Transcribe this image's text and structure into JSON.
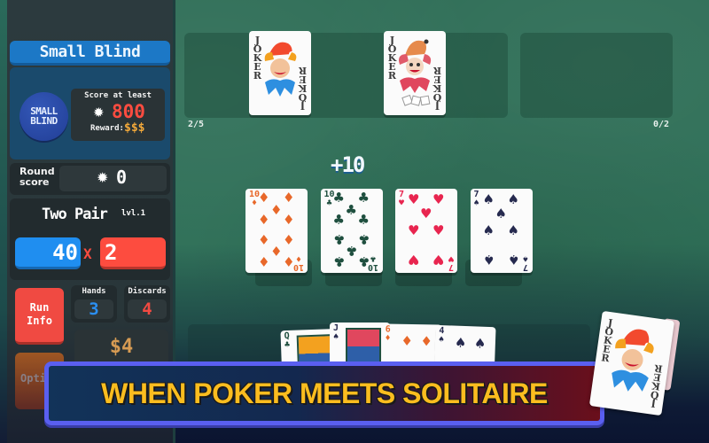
{
  "sidebar": {
    "blind_title": "Small Blind",
    "blind_chip": [
      "SMALL",
      "BLIND"
    ],
    "score_label": "Score at least",
    "score_icon": "chip-icon",
    "score_target": "800",
    "reward_label": "Reward:",
    "reward_value": "$$$",
    "round_label_1": "Round",
    "round_label_2": "score",
    "round_score": "0",
    "hand_name": "Two Pair",
    "hand_level": "lvl.1",
    "chips": "40",
    "times": "X",
    "mult": "2",
    "run_info_1": "Run",
    "run_info_2": "Info",
    "options": "Options",
    "hands_label": "Hands",
    "hands_value": "3",
    "discards_label": "Discards",
    "discards_value": "4",
    "money": "$4"
  },
  "jokers": {
    "count": "2/5",
    "cards": [
      {
        "label": "JOKER",
        "variant": "classic-jester"
      },
      {
        "label": "JOKER",
        "variant": "red-jester-dice"
      }
    ]
  },
  "consumables": {
    "count": "0/2"
  },
  "played": {
    "score_popup": "+10",
    "cards": [
      {
        "rank": "10",
        "suit": "♦",
        "color": "#e8682a"
      },
      {
        "rank": "10",
        "suit": "♣",
        "color": "#1f4f3f"
      },
      {
        "rank": "7",
        "suit": "♥",
        "color": "#e8254f"
      },
      {
        "rank": "7",
        "suit": "♠",
        "color": "#262a4f"
      }
    ]
  },
  "hand": {
    "cards": [
      {
        "rank": "Q",
        "suit": "♣",
        "color": "#1f4f3f"
      },
      {
        "rank": "J",
        "suit": "♠",
        "color": "#262a4f"
      },
      {
        "rank": "6",
        "suit": "♦",
        "color": "#e8682a"
      },
      {
        "rank": "4",
        "suit": "♠",
        "color": "#262a4f"
      }
    ]
  },
  "deck": {
    "top_card": "JOKER"
  },
  "banner": {
    "text": "WHEN POKER MEETS SOLITAIRE"
  }
}
